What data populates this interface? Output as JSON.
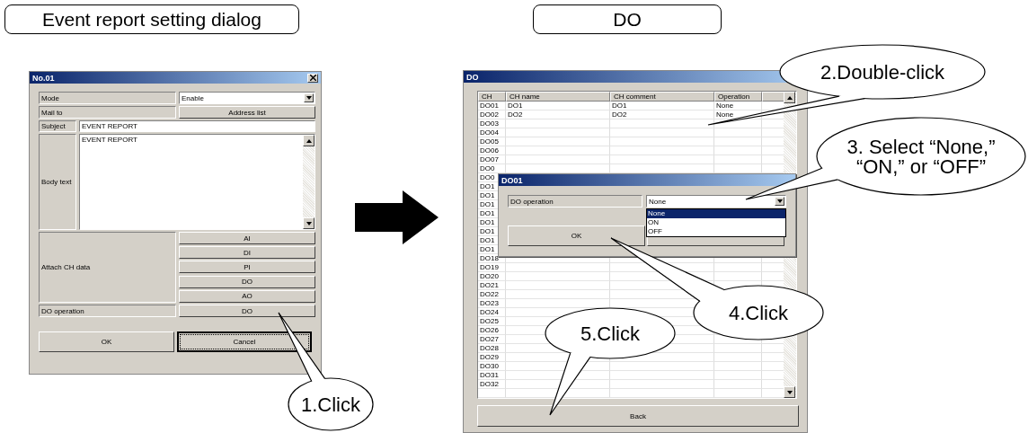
{
  "headings": [
    {
      "text": "Event report setting dialog"
    },
    {
      "text": "DO"
    }
  ],
  "settings_dialog": {
    "title": "No.01",
    "mode": {
      "label": "Mode",
      "value": "Enable"
    },
    "mail_to": {
      "label": "Mail to",
      "button": "Address list"
    },
    "subject": {
      "label": "Subject",
      "value": "EVENT REPORT"
    },
    "body_text": {
      "label": "Body text",
      "value": "EVENT REPORT"
    },
    "attach_ch_data": {
      "label": "Attach CH data",
      "buttons": [
        "AI",
        "DI",
        "PI",
        "DO",
        "AO"
      ]
    },
    "do_operation": {
      "label": "DO operation",
      "button": "DO"
    },
    "buttons": [
      {
        "label": "OK",
        "focused": false
      },
      {
        "label": "Cancel",
        "focused": true
      }
    ]
  },
  "do_window": {
    "title": "DO",
    "table": {
      "columns": [
        "CH",
        "CH name",
        "CH comment",
        "Operation"
      ],
      "rows": [
        {
          "ch": "DO01",
          "name": "DO1",
          "comment": "DO1",
          "operation": "None"
        },
        {
          "ch": "DO02",
          "name": "DO2",
          "comment": "DO2",
          "operation": "None"
        },
        {
          "ch": "DO03"
        },
        {
          "ch": "DO04"
        },
        {
          "ch": "DO05"
        },
        {
          "ch": "DO06"
        },
        {
          "ch": "DO07"
        },
        {
          "ch": "DO0"
        },
        {
          "ch": "DO0"
        },
        {
          "ch": "DO1"
        },
        {
          "ch": "DO1"
        },
        {
          "ch": "DO1"
        },
        {
          "ch": "DO1"
        },
        {
          "ch": "DO1"
        },
        {
          "ch": "DO1"
        },
        {
          "ch": "DO1"
        },
        {
          "ch": "DO1"
        },
        {
          "ch": "DO18"
        },
        {
          "ch": "DO19"
        },
        {
          "ch": "DO20"
        },
        {
          "ch": "DO21"
        },
        {
          "ch": "DO22"
        },
        {
          "ch": "DO23"
        },
        {
          "ch": "DO24"
        },
        {
          "ch": "DO25"
        },
        {
          "ch": "DO26"
        },
        {
          "ch": "DO27"
        },
        {
          "ch": "DO28"
        },
        {
          "ch": "DO29"
        },
        {
          "ch": "DO30"
        },
        {
          "ch": "DO31"
        },
        {
          "ch": "DO32"
        }
      ]
    },
    "back_button": "Back"
  },
  "do01_dialog": {
    "title": "DO01",
    "label": "DO operation",
    "value": "None",
    "options": [
      {
        "label": "None",
        "selected": true
      },
      {
        "label": "ON",
        "selected": false
      },
      {
        "label": "OFF",
        "selected": false
      }
    ],
    "ok_button": "OK"
  },
  "callouts": [
    {
      "lines": [
        "1.Click"
      ]
    },
    {
      "lines": [
        "2.Double-click"
      ]
    },
    {
      "lines": [
        "3. Select “None,”",
        "“ON,” or “OFF”"
      ]
    },
    {
      "lines": [
        "4.Click"
      ]
    },
    {
      "lines": [
        "5.Click"
      ]
    }
  ]
}
